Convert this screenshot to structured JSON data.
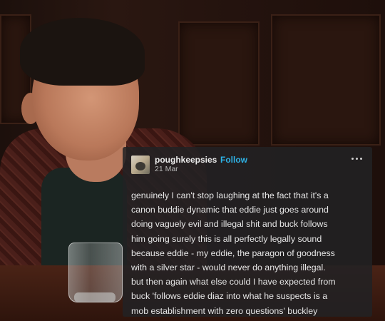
{
  "post": {
    "username": "poughkeepsies",
    "follow_label": "Follow",
    "date": "21 Mar",
    "more_icon": "ellipsis-icon",
    "lines": [
      "genuinely I can't stop laughing at the fact that it's a",
      "canon buddie dynamic that eddie just goes around",
      "doing vaguely evil and illegal shit and buck follows",
      "him going surely this is all perfectly legally sound",
      "because eddie - my eddie, the paragon of goodness",
      "with a silver star - would never do anything illegal.",
      "but then again what else could I have expected from",
      "buck 'follows eddie diaz into what he suspects is a",
      "mob establishment with zero questions' buckley"
    ]
  },
  "colors": {
    "card_background": "#222224",
    "follow_accent": "#2eb2e6",
    "text": "#e6e6e6"
  }
}
